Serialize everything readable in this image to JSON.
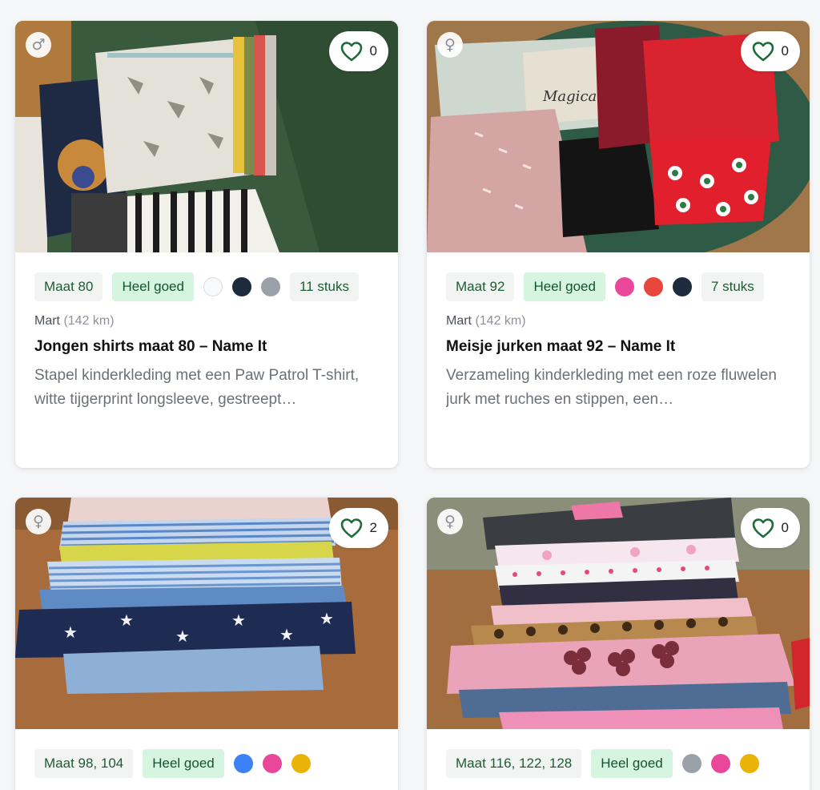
{
  "listings": [
    {
      "gender_icon": "male-symbol-icon",
      "gender_glyph": "♂",
      "likes": "0",
      "size": "Maat 80",
      "condition": "Heel goed",
      "colors": [
        "#f8f9fb",
        "#1e2a3d",
        "#9aa1a9"
      ],
      "count": "11 stuks",
      "seller": "Mart",
      "distance": "(142 km)",
      "title": "Jongen shirts maat 80 – Name It",
      "description": "Stapel kinderkleding met een Paw Patrol T-shirt, witte tijgerprint longsleeve, gestreept…"
    },
    {
      "gender_icon": "female-symbol-icon",
      "gender_glyph": "♀",
      "likes": "0",
      "size": "Maat 92",
      "condition": "Heel goed",
      "colors": [
        "#e9489a",
        "#e8453c",
        "#1e2a3d"
      ],
      "count": "7 stuks",
      "seller": "Mart",
      "distance": "(142 km)",
      "title": "Meisje jurken maat 92 – Name It",
      "description": "Verzameling kinderkleding met een roze fluwelen jurk met ruches en stippen, een…"
    },
    {
      "gender_icon": "female-symbol-icon",
      "gender_glyph": "♀",
      "likes": "2",
      "size": "Maat 98, 104",
      "condition": "Heel goed",
      "colors": [
        "#3b82f6",
        "#e9489a",
        "#eab308"
      ]
    },
    {
      "gender_icon": "female-symbol-icon",
      "gender_glyph": "♀",
      "likes": "0",
      "size": "Maat 116, 122, 128",
      "condition": "Heel goed",
      "colors": [
        "#9aa1a9",
        "#e9489a",
        "#eab308"
      ]
    }
  ],
  "theme": {
    "heart_color": "#1d6b3a",
    "tag_text": "#1d5b35",
    "condition_bg": "#d6f5e0"
  }
}
